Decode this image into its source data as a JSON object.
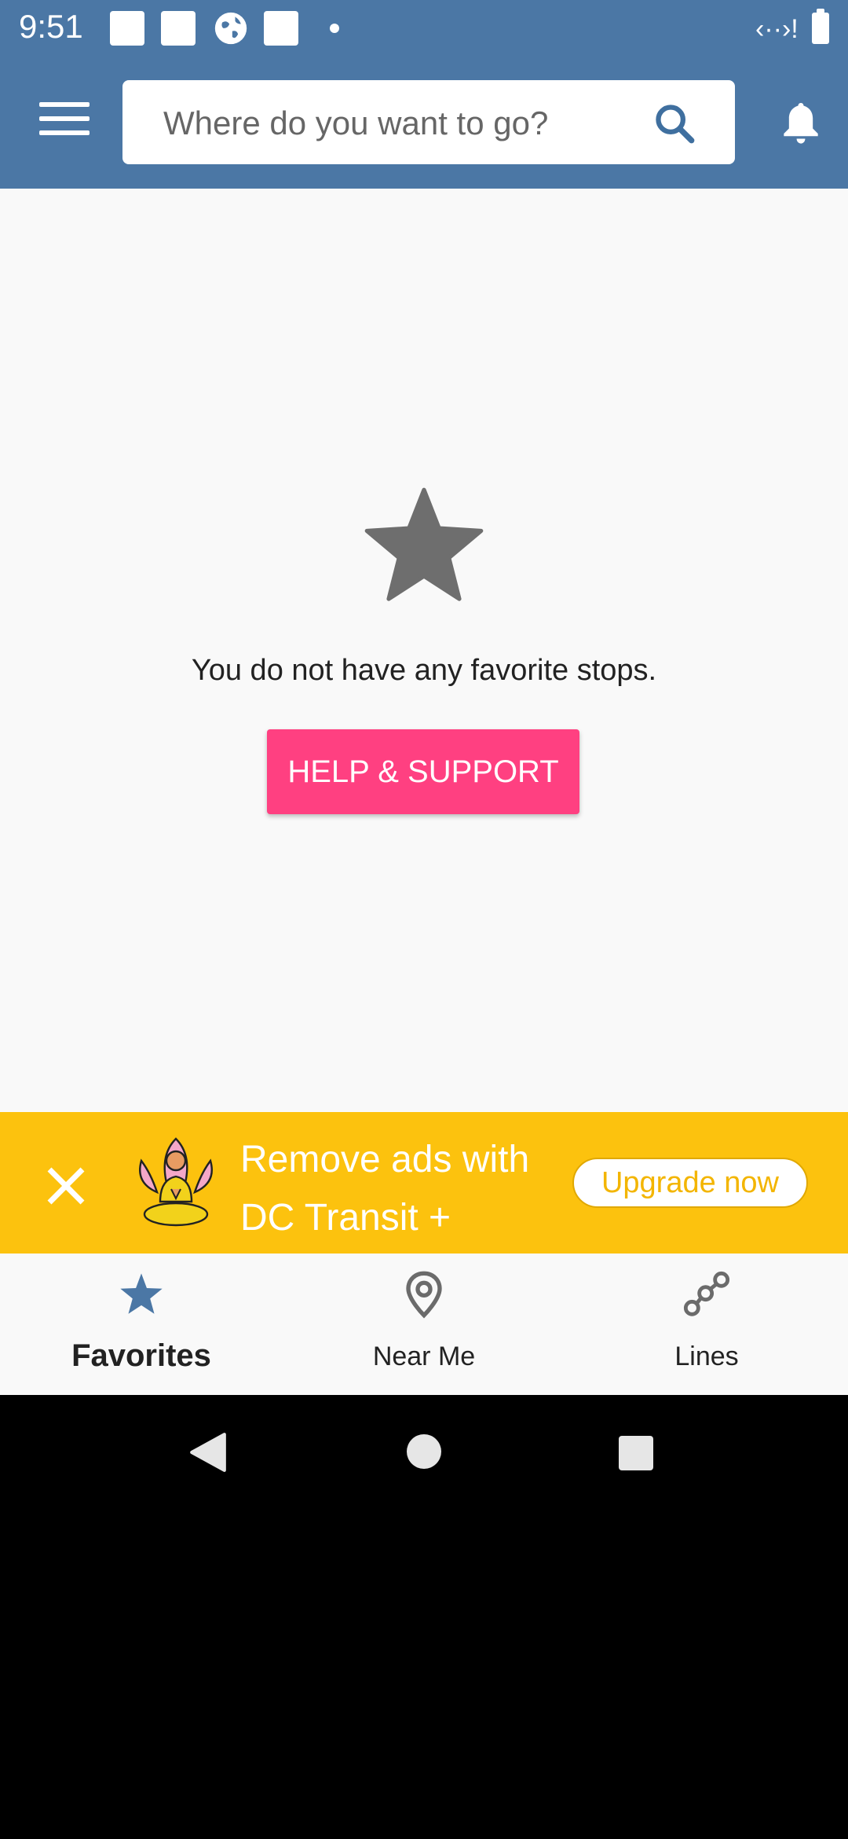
{
  "status_bar": {
    "time": "9:51"
  },
  "header": {
    "search_placeholder": "Where do you want to go?"
  },
  "empty_state": {
    "message": "You do not have any favorite stops.",
    "help_button": "HELP & SUPPORT"
  },
  "ad_banner": {
    "text_line1": "Remove ads with",
    "text_line2": "DC Transit +",
    "upgrade_label": "Upgrade now"
  },
  "bottom_nav": {
    "items": [
      {
        "label": "Favorites",
        "icon": "star-icon",
        "active": true
      },
      {
        "label": "Near Me",
        "icon": "location-pin-icon",
        "active": false
      },
      {
        "label": "Lines",
        "icon": "lines-network-icon",
        "active": false
      }
    ]
  },
  "colors": {
    "primary": "#4b77a5",
    "accent": "#ff4081",
    "ad_banner": "#fcc20e",
    "background": "#f9f9f9"
  }
}
